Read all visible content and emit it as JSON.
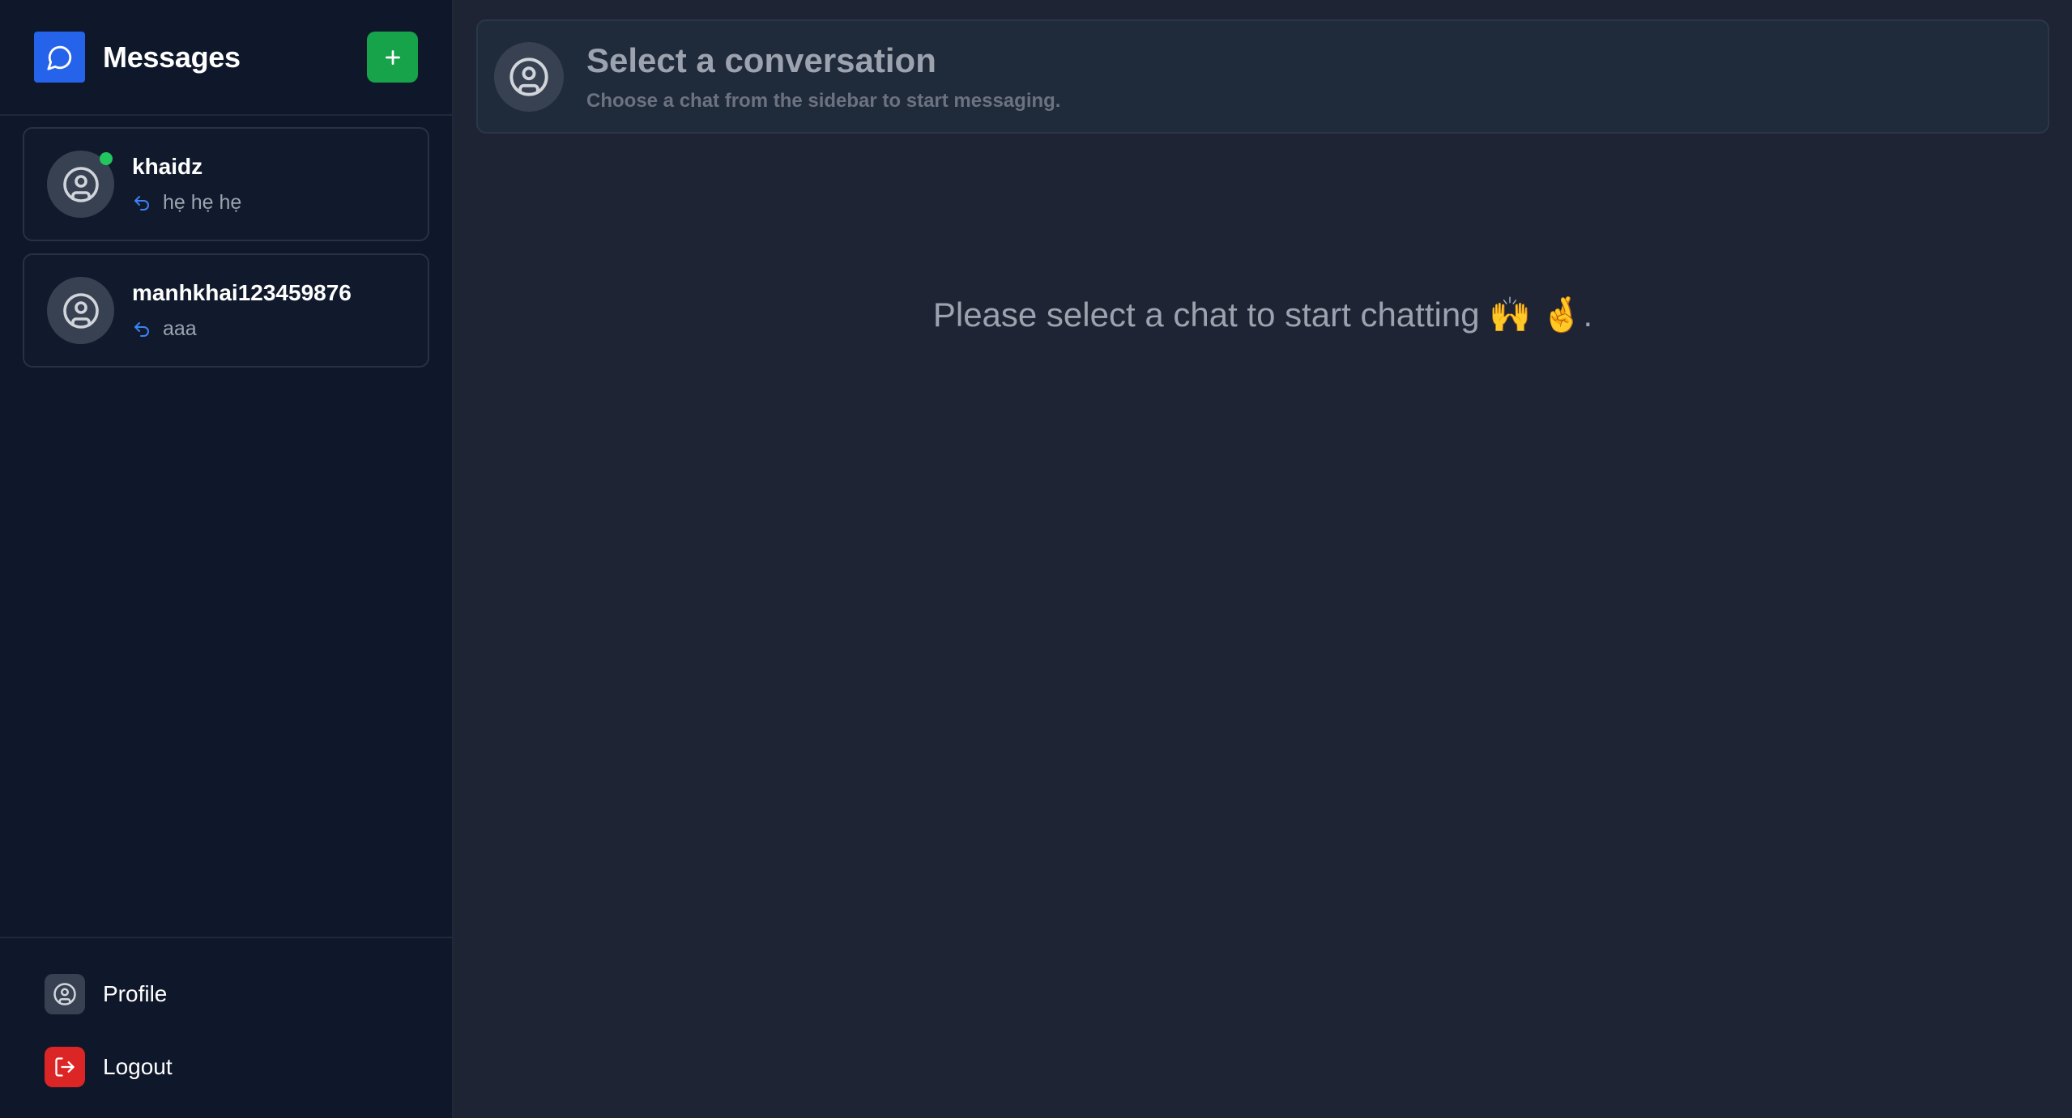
{
  "sidebar": {
    "title": "Messages",
    "conversations": [
      {
        "name": "khaidz",
        "last_message": "hẹ hẹ hẹ",
        "online": true
      },
      {
        "name": "manhkhai123459876",
        "last_message": "aaa",
        "online": false
      }
    ],
    "footer": {
      "profile_label": "Profile",
      "logout_label": "Logout"
    }
  },
  "main": {
    "header_title": "Select a conversation",
    "header_subtitle": "Choose a chat from the sidebar to start messaging.",
    "empty_message": "Please select a chat to start chatting 🙌 🤞."
  },
  "colors": {
    "brand": "#2563eb",
    "new_button": "#16a34a",
    "online": "#22c55e",
    "logout": "#dc2626"
  }
}
